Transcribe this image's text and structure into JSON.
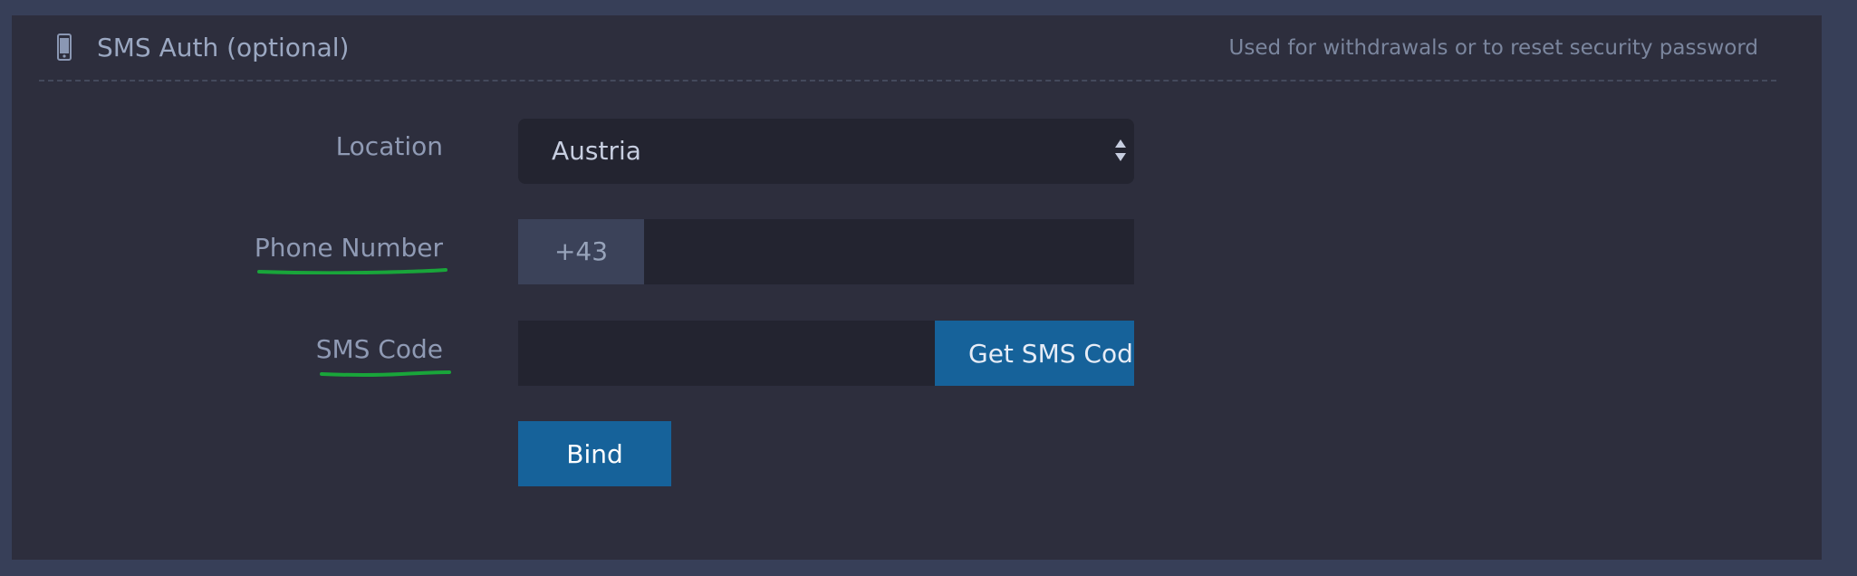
{
  "section": {
    "title": "SMS Auth (optional)",
    "note": "Used for withdrawals or to reset security password",
    "icon": "phone-icon"
  },
  "form": {
    "location_label": "Location",
    "location_value": "Austria",
    "phone_label": "Phone Number",
    "phone_prefix": "+43",
    "phone_value": "",
    "sms_label": "SMS Code",
    "sms_value": "",
    "get_code_label": "Get SMS Code",
    "bind_label": "Bind"
  },
  "colors": {
    "page_background": "#373f58",
    "panel_background": "#2d2e3d",
    "input_background": "#232430",
    "primary_button": "#16629a",
    "label_underline": "#19a53a"
  }
}
